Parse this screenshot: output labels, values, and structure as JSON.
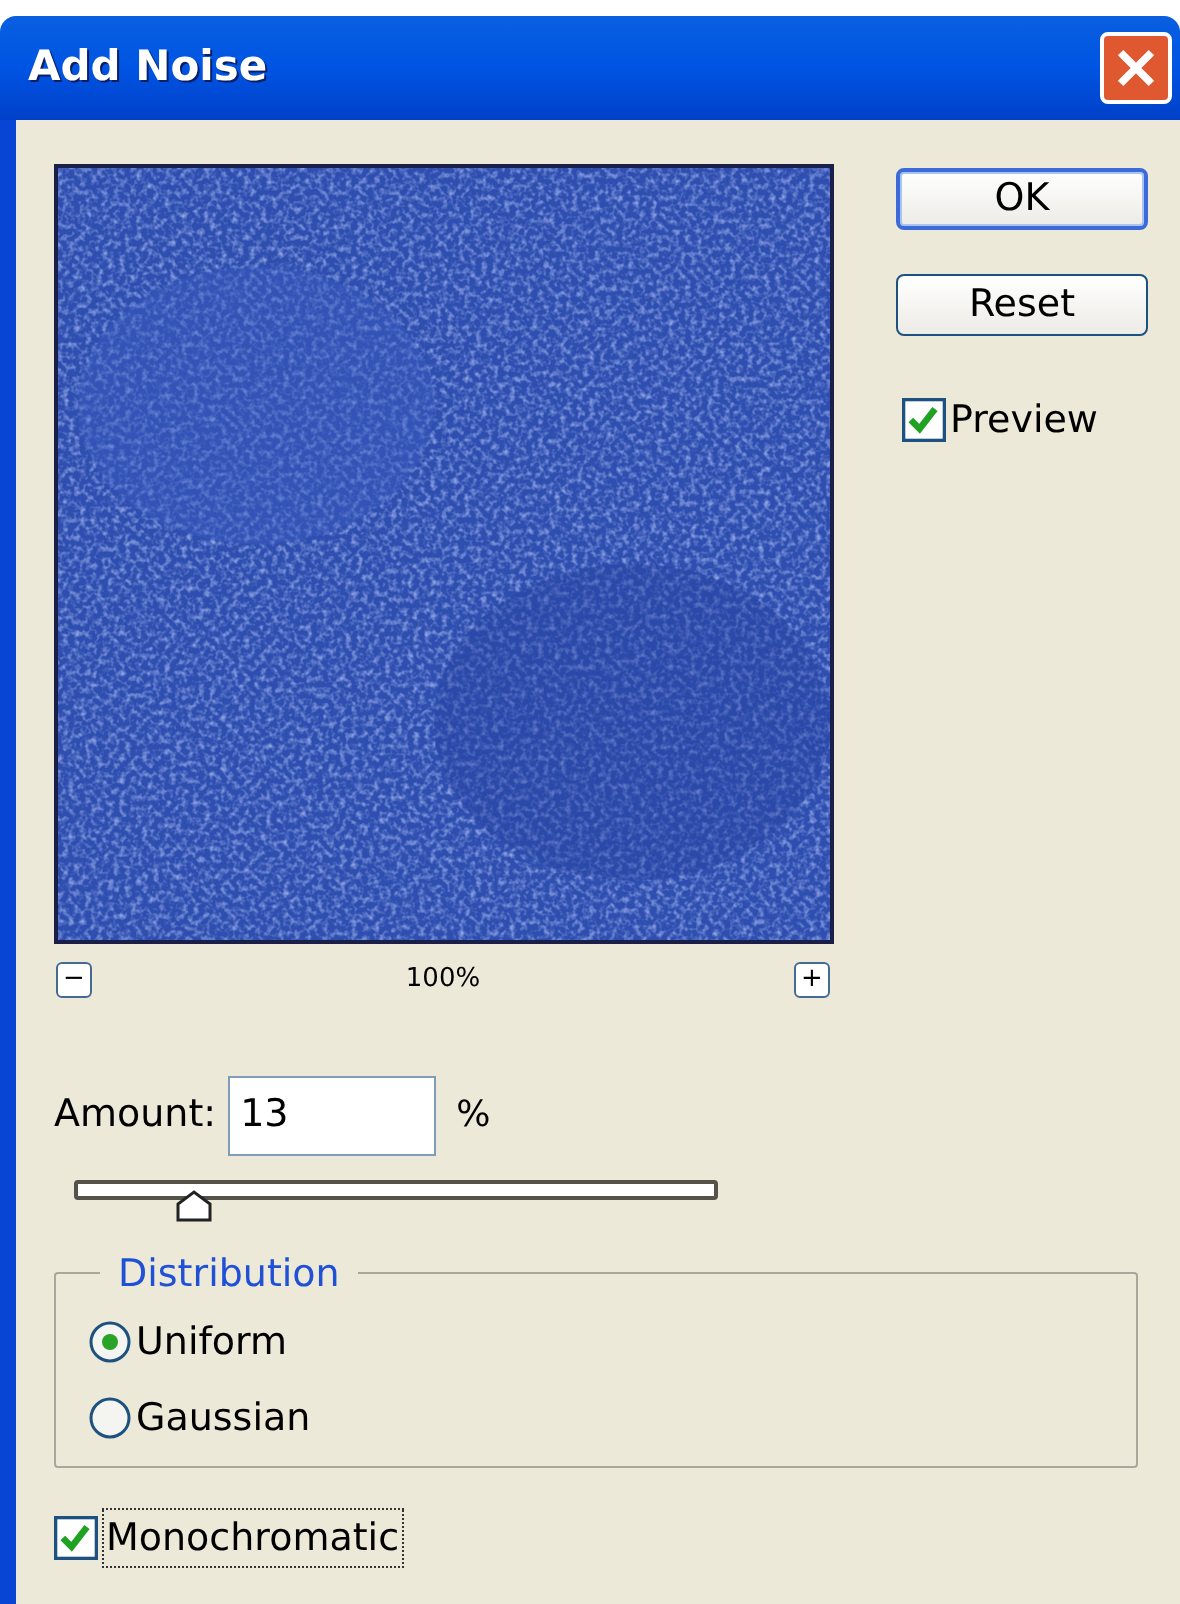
{
  "window": {
    "title": "Add Noise"
  },
  "buttons": [
    {
      "label": "OK",
      "selected": true
    },
    {
      "label": "Reset",
      "selected": false
    }
  ],
  "preview_checkbox": {
    "label": "Preview",
    "checked": true
  },
  "zoom": {
    "minus": "−",
    "level": "100%",
    "plus": "+"
  },
  "amount": {
    "label": "Amount:",
    "value": "13",
    "unit": "%"
  },
  "amount_slider": {
    "level": 0.16
  },
  "distribution": {
    "title": "Distribution",
    "options": [
      {
        "label": "Uniform",
        "selected": true
      },
      {
        "label": "Gaussian",
        "selected": false
      }
    ]
  },
  "monochromatic": {
    "label": "Monochromatic",
    "checked": true
  }
}
